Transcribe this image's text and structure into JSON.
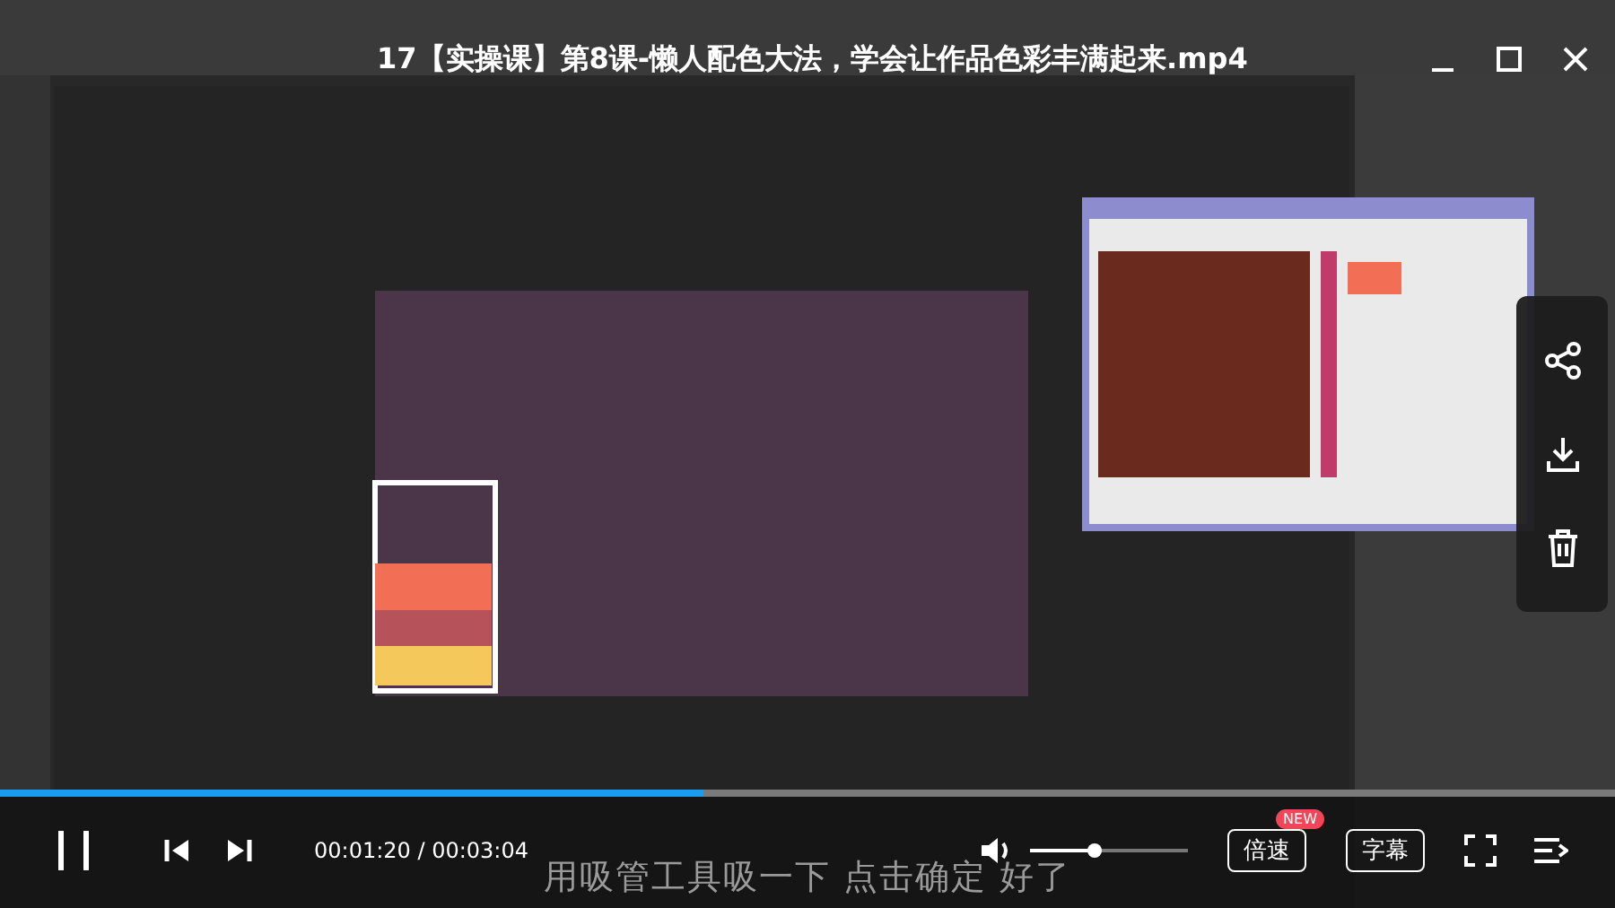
{
  "title": "17【实操课】第8课-懒人配色大法，学会让作品色彩丰满起来.mp4",
  "progress": {
    "level": 0.435
  },
  "time": {
    "current": "00:01:20",
    "separator": "/",
    "total": "00:03:04"
  },
  "subtitle": "用吸管工具吸一下 点击确定 好了",
  "volume": {
    "level": 0.41
  },
  "speed_button": {
    "label": "倍速",
    "badge": "NEW"
  },
  "caption_button": {
    "label": "字幕"
  },
  "playing": true
}
